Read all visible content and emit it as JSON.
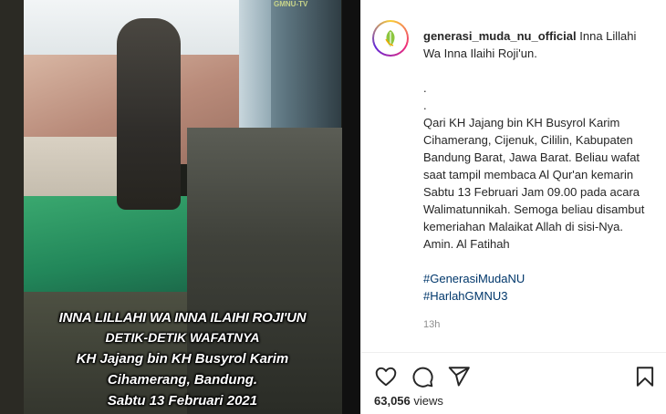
{
  "video": {
    "watermark": "GMNU-TV",
    "caption_lines": [
      "INNA LILLAHI WA INNA ILAIHI ROJI'UN",
      "DETIK-DETIK WAFATNYA",
      "KH Jajang bin KH Busyrol Karim",
      "Cihamerang, Bandung.",
      "Sabtu 13 Februari 2021"
    ]
  },
  "post": {
    "username": "generasi_muda_nu_official",
    "intro": "Inna Lillahi Wa Inna Ilaihi Roji'un.",
    "dot1": ".",
    "dot2": ".",
    "body": "Qari KH Jajang bin KH Busyrol Karim Cihamerang, Cijenuk, Cililin, Kabupaten Bandung Barat, Jawa Barat. Beliau wafat saat tampil membaca Al Qur'an kemarin Sabtu 13 Februari Jam 09.00 pada acara Walimatunnikah. Semoga beliau disambut kemeriahan Malaikat Allah di sisi-Nya. Amin. Al Fatihah",
    "hashtags": [
      "#GenerasiMudaNU",
      "#HarlahGMNU3"
    ],
    "time": "13h",
    "views_count": "63,056",
    "views_label": "views"
  },
  "icons": {
    "like": "heart-icon",
    "comment": "comment-icon",
    "share": "share-icon",
    "save": "bookmark-icon"
  },
  "colors": {
    "hashtag": "#00376b",
    "text": "#262626",
    "muted": "#8e8e8e"
  }
}
